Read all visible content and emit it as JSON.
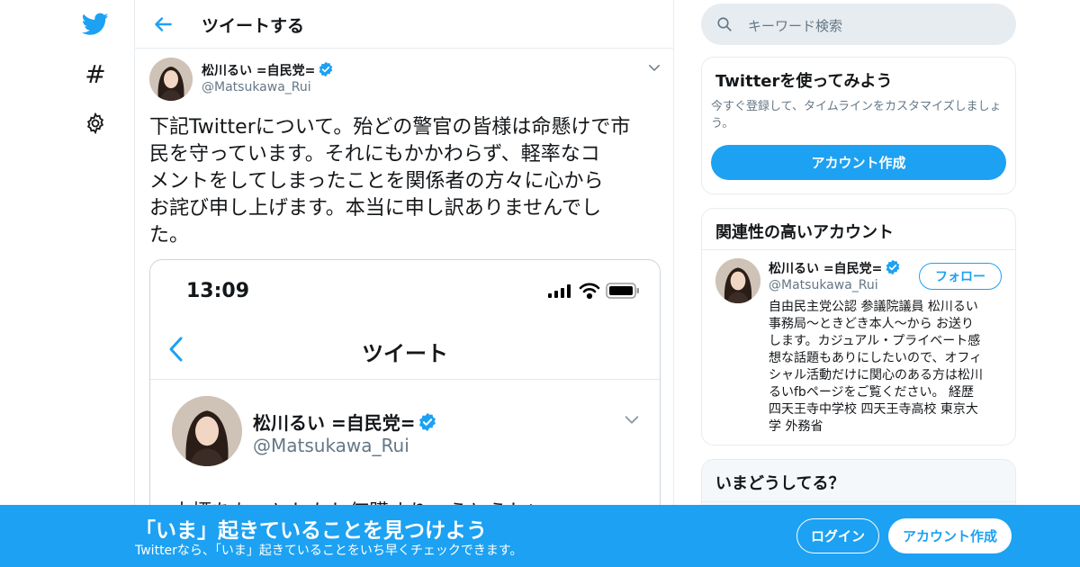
{
  "colors": {
    "accent": "#1da1f2",
    "text": "#14171a",
    "muted": "#657786",
    "border": "#e6ecf0"
  },
  "nav": {
    "icons": [
      "twitter-logo-icon",
      "hashtag-icon",
      "gear-icon"
    ],
    "hashtag_glyph": "#"
  },
  "header": {
    "title": "ツイートする"
  },
  "tweet": {
    "name": "松川るい =自民党=",
    "handle": "@Matsukawa_Rui",
    "lines": [
      "下記Twitterについて。殆どの警官の皆様は命懸けで市",
      "民を守っています。それにもかかわらず、軽率なコ",
      "メントをしてしまったことを関係者の方々に心から",
      "お詫び申し上げます。本当に申し訳ありませんでし",
      "た。"
    ],
    "embed": {
      "time": "13:09",
      "title": "ツイート",
      "name": "松川るい =自民党=",
      "handle": "@Matsukawa_Rui",
      "cut_text": "本標をもつとしかし価購すりょうとうしい"
    }
  },
  "search": {
    "placeholder": "キーワード検索"
  },
  "signup_card": {
    "title": "Twitterを使ってみよう",
    "line1": "今すぐ登録して、タイムラインをカスタマイズしましょ",
    "line2": "う。",
    "button": "アカウント作成"
  },
  "related_card": {
    "title": "関連性の高いアカウント",
    "name": "松川るい =自民党=",
    "handle": "@Matsukawa_Rui",
    "follow": "フォロー",
    "bio_lines": [
      "自由民主党公認 参議院議員 松川るい",
      "事務局～ときどき本人～から お送り",
      "します。カジュアル・プライベート感",
      "想な話題もありにしたいので、オフィ",
      "シャル活動だけに関心のある方は松川",
      "るいfbページをご覧ください。 経歴",
      "四天王寺中学校 四天王寺高校 東京大",
      "学 外務省"
    ]
  },
  "trends_card": {
    "title": "いまどうしてる？"
  },
  "banner": {
    "title": "「いま」起きていることを見つけよう",
    "subtitle": "Twitterなら、「いま」起きていることをいち早くチェックできます。",
    "login": "ログイン",
    "signup": "アカウント作成"
  }
}
